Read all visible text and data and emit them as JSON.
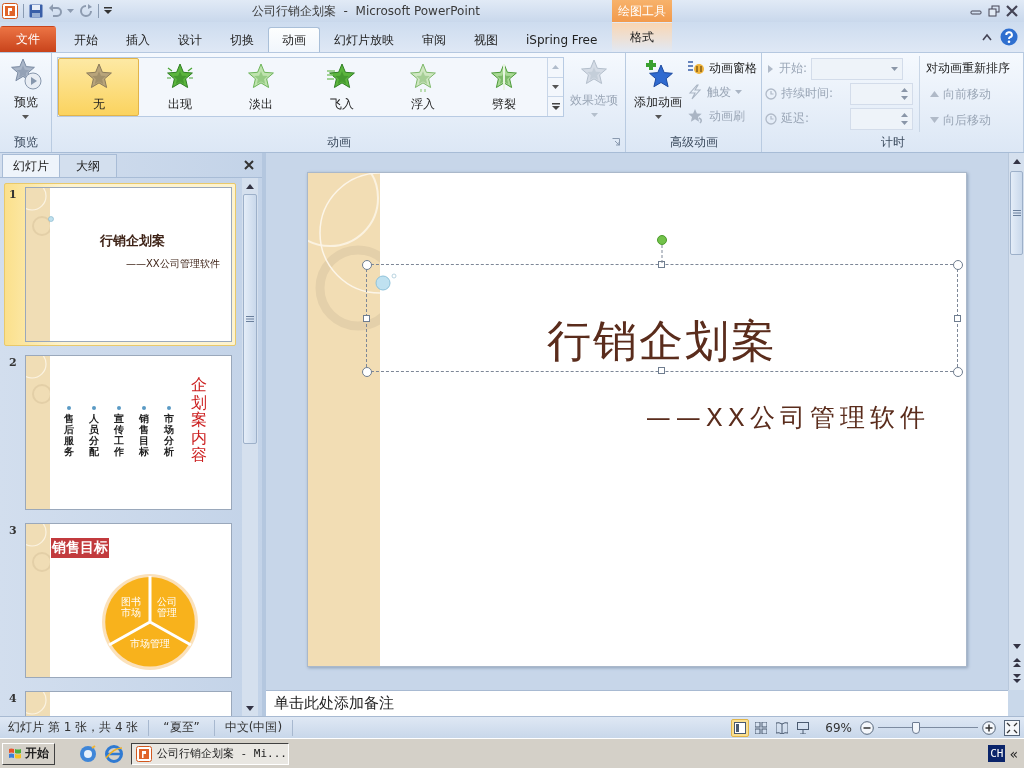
{
  "title_bar": {
    "title": "公司行销企划案  -  Microsoft PowerPoint",
    "context_label": "绘图工具"
  },
  "ribbon_tabs": [
    {
      "label": "文件",
      "kind": "file",
      "selected": false
    },
    {
      "label": "开始",
      "kind": "normal",
      "selected": false
    },
    {
      "label": "插入",
      "kind": "normal",
      "selected": false
    },
    {
      "label": "设计",
      "kind": "normal",
      "selected": false
    },
    {
      "label": "切换",
      "kind": "normal",
      "selected": false
    },
    {
      "label": "动画",
      "kind": "normal",
      "selected": true
    },
    {
      "label": "幻灯片放映",
      "kind": "normal",
      "selected": false
    },
    {
      "label": "审阅",
      "kind": "normal",
      "selected": false
    },
    {
      "label": "视图",
      "kind": "normal",
      "selected": false
    },
    {
      "label": "iSpring Free",
      "kind": "normal",
      "selected": false
    },
    {
      "label": "格式",
      "kind": "context",
      "selected": false
    }
  ],
  "ribbon": {
    "preview": {
      "button": "预览",
      "group_label": "预览"
    },
    "animation": {
      "group_label": "动画",
      "effects": [
        {
          "label": "无",
          "kind": "none",
          "selected": true
        },
        {
          "label": "出现",
          "kind": "appear",
          "selected": false
        },
        {
          "label": "淡出",
          "kind": "fade",
          "selected": false
        },
        {
          "label": "飞入",
          "kind": "fly",
          "selected": false
        },
        {
          "label": "浮入",
          "kind": "float",
          "selected": false
        },
        {
          "label": "劈裂",
          "kind": "split",
          "selected": false
        }
      ],
      "options": {
        "label": "效果选项",
        "disabled": true
      }
    },
    "advanced": {
      "group_label": "高级动画",
      "add": "添加动画",
      "items": [
        {
          "label": "动画窗格",
          "kind": "pane",
          "disabled": false
        },
        {
          "label": "触发",
          "kind": "trigger",
          "disabled": true
        },
        {
          "label": "动画刷",
          "kind": "painter",
          "disabled": true
        }
      ]
    },
    "timing": {
      "group_label": "计时",
      "fields": [
        {
          "label": "开始:",
          "kind": "dropdown",
          "disabled": true
        },
        {
          "label": "持续时间:",
          "kind": "spinner",
          "disabled": true
        },
        {
          "label": "延迟:",
          "kind": "spinner",
          "disabled": true
        }
      ],
      "reorder_title": "对动画重新排序",
      "reorder": [
        {
          "label": "向前移动",
          "kind": "up",
          "disabled": true
        },
        {
          "label": "向后移动",
          "kind": "down",
          "disabled": true
        }
      ]
    }
  },
  "slides_panel": {
    "tabs": [
      {
        "label": "幻灯片",
        "selected": true
      },
      {
        "label": "大纲",
        "selected": false
      }
    ],
    "thumbnails": [
      {
        "number": "1",
        "kind": "title",
        "selected": true,
        "title": "行销企划案",
        "subtitle": "——XX公司管理软件"
      },
      {
        "number": "2",
        "kind": "list",
        "selected": false,
        "heading": "企划案内容",
        "items": [
          "售后服务",
          "人员分配",
          "宣传工作",
          "销售目标",
          "市场分析"
        ]
      },
      {
        "number": "3",
        "kind": "chart",
        "selected": false,
        "heading": "销售目标",
        "segments": [
          "图书市场",
          "公司管理",
          "市场管理"
        ]
      },
      {
        "number": "4",
        "kind": "cut",
        "selected": false
      }
    ]
  },
  "slide": {
    "title": "行销企划案",
    "subtitle": "——XX公司管理软件"
  },
  "notes": {
    "prompt": "单击此处添加备注"
  },
  "status_bar": {
    "slide_info": "幻灯片 第 1 张，共 4 张",
    "theme": "“夏至”",
    "language": "中文(中国)",
    "views": [
      {
        "kind": "normal",
        "selected": true
      },
      {
        "kind": "sorter",
        "selected": false
      },
      {
        "kind": "reading",
        "selected": false
      },
      {
        "kind": "show",
        "selected": false
      }
    ],
    "zoom": {
      "reading": "69%",
      "level": 0.38
    }
  },
  "taskbar": {
    "start": "开始",
    "tasks": [
      {
        "label": "公司行销企划案 - Mi...",
        "selected": true
      }
    ],
    "language": "CH",
    "tray_toggle": "«"
  }
}
